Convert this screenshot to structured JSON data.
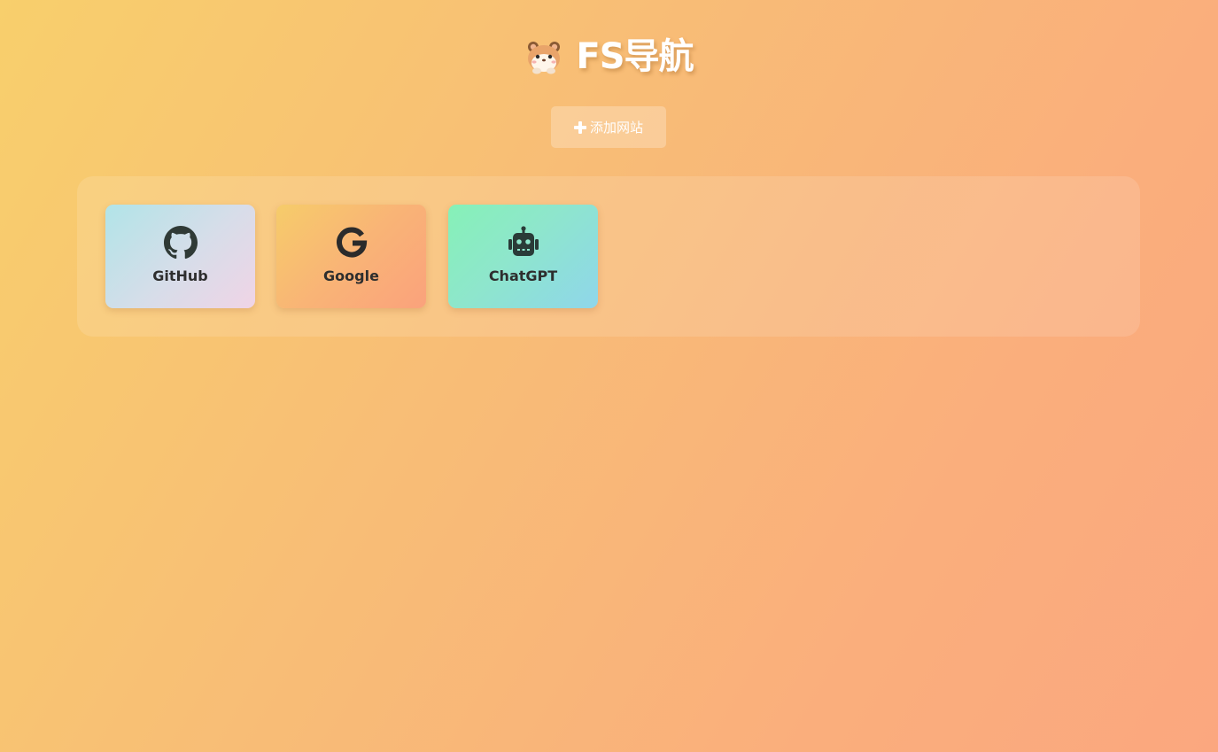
{
  "header": {
    "title": "FS导航",
    "logo_icon": "hamster-icon"
  },
  "toolbar": {
    "add_label": "添加网站",
    "add_icon": "plus-icon"
  },
  "sites": [
    {
      "label": "GitHub",
      "icon": "github-icon"
    },
    {
      "label": "Google",
      "icon": "google-icon"
    },
    {
      "label": "ChatGPT",
      "icon": "robot-icon"
    }
  ],
  "colors": {
    "background_start": "#f8cf6c",
    "background_end": "#fba77f",
    "title": "#ffffff",
    "card_text": "#2e2e2e",
    "icon_dark": "#2f3a36"
  }
}
